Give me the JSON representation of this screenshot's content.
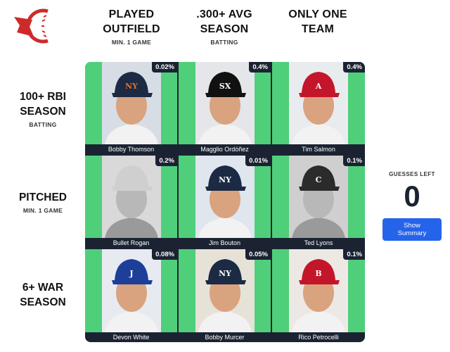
{
  "colors": {
    "grid_bg": "#1b2333",
    "cell_green": "#4fcf7a",
    "logo_red": "#cf2a2a",
    "button_blue": "#2563eb"
  },
  "logo": {
    "icon": "baseball-logo-icon"
  },
  "columns": [
    {
      "title": "PLAYED\nOUTFIELD",
      "subtitle": "MIN. 1 GAME"
    },
    {
      "title": ".300+ AVG\nSEASON",
      "subtitle": "BATTING"
    },
    {
      "title": "ONLY ONE\nTEAM",
      "subtitle": ""
    }
  ],
  "rows": [
    {
      "title": "100+ RBI\nSEASON",
      "subtitle": "BATTING"
    },
    {
      "title": "PITCHED",
      "subtitle": "MIN. 1 GAME"
    },
    {
      "title": "6+ WAR\nSEASON",
      "subtitle": ""
    }
  ],
  "cells": [
    {
      "name": "Bobby Thomson",
      "pct": "0.02%",
      "cap": "#1c2a44",
      "logo": "NY",
      "logo_color": "#e0702a",
      "bg": "#d7dde4",
      "bw": false
    },
    {
      "name": "Magglio Ordóñez",
      "pct": "0.4%",
      "cap": "#111111",
      "logo": "SX",
      "logo_color": "#ffffff",
      "bg": "#e4e6ea",
      "bw": false
    },
    {
      "name": "Tim Salmon",
      "pct": "0.4%",
      "cap": "#c4162a",
      "logo": "A",
      "logo_color": "#ffffff",
      "bg": "#e9ecef",
      "bw": false
    },
    {
      "name": "Bullet Rogan",
      "pct": "0.2%",
      "cap": "#cfcfcf",
      "logo": "",
      "logo_color": "#333333",
      "bg": "#d9d9d9",
      "bw": true
    },
    {
      "name": "Jim Bouton",
      "pct": "0.01%",
      "cap": "#1c2a44",
      "logo": "NY",
      "logo_color": "#ffffff",
      "bg": "#dfe6ee",
      "bw": false
    },
    {
      "name": "Ted Lyons",
      "pct": "0.1%",
      "cap": "#2b2b2b",
      "logo": "C",
      "logo_color": "#ffffff",
      "bg": "#cfcfcf",
      "bw": true
    },
    {
      "name": "Devon White",
      "pct": "0.08%",
      "cap": "#1d3f9a",
      "logo": "J",
      "logo_color": "#ffffff",
      "bg": "#e7ebf1",
      "bw": false
    },
    {
      "name": "Bobby Murcer",
      "pct": "0.05%",
      "cap": "#1c2a44",
      "logo": "NY",
      "logo_color": "#ffffff",
      "bg": "#e6e2d8",
      "bw": false
    },
    {
      "name": "Rico Petrocelli",
      "pct": "0.1%",
      "cap": "#c4162a",
      "logo": "B",
      "logo_color": "#ffffff",
      "bg": "#ece9e4",
      "bw": false
    }
  ],
  "guesses": {
    "label": "GUESSES LEFT",
    "count": "0",
    "button": "Show Summary"
  }
}
